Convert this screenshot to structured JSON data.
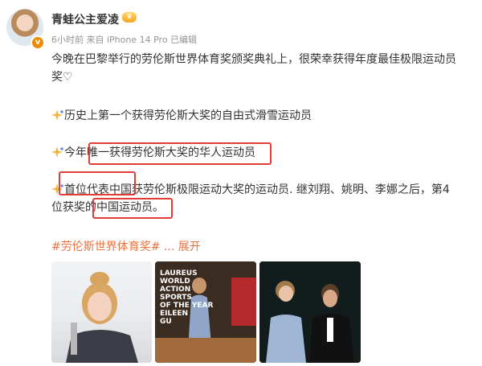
{
  "post": {
    "username": "青蛙公主爱凌",
    "meta": "6小时前  来自 iPhone 14 Pro  已编辑",
    "line1": "今晚在巴黎举行的劳伦斯世界体育奖颁奖典礼上，很荣幸获得年度最佳极限运动员",
    "line2": "奖",
    "bullet1": "历史上第一个获得劳伦斯大奖的自由式滑雪运动员",
    "bullet2": "今年唯一获得劳伦斯大奖的华人运动员",
    "bullet3_line1": "首位代表中国获劳伦斯极限运动大奖的运动员. 继刘翔、姚明、李娜之后，第4",
    "bullet3_line2": "位获奖的中国运动员。",
    "hashtag": "#劳伦斯世界体育奖#",
    "expand_label": "... 展开"
  },
  "photo2_text": "LAUREUS\nWORLD\nACTION\nSPORTS\nOF THE YEAR\nEILEEN\nGU",
  "colors": {
    "accent": "#eb7340",
    "highlight_box": "#e33a3a",
    "meta_gray": "#939393"
  },
  "icons": [
    "heart-outline-icon",
    "sparkle-emoji-icon",
    "verified-badge-icon",
    "crown-badge-icon"
  ]
}
